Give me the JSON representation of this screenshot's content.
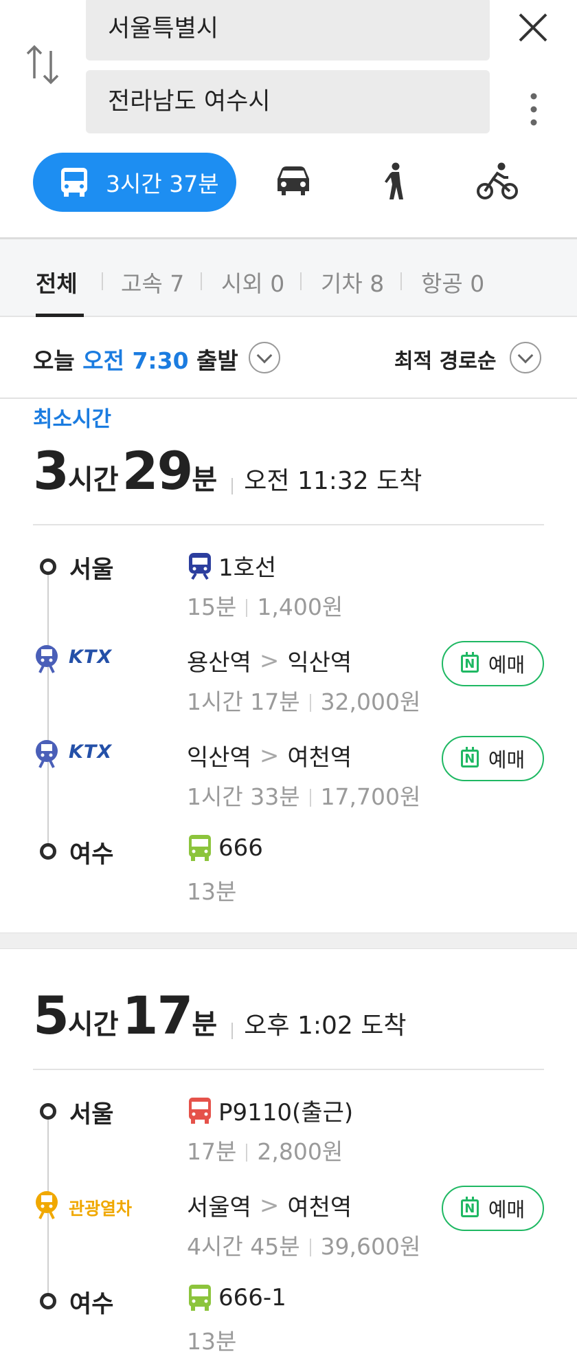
{
  "search": {
    "origin": "서울특별시",
    "destination": "전라남도 여수시"
  },
  "modes": {
    "transit_time": "3시간 37분",
    "icons": [
      "bus-icon",
      "car-icon",
      "walk-icon",
      "bicycle-icon"
    ],
    "accent": "#1d8ef2"
  },
  "filters": [
    {
      "label": "전체"
    },
    {
      "label": "고속 7"
    },
    {
      "label": "시외 0"
    },
    {
      "label": "기차 8"
    },
    {
      "label": "항공 0"
    }
  ],
  "departure": {
    "day": "오늘",
    "time": "오전 7:30",
    "suffix": "출발",
    "sort": "최적 경로순"
  },
  "routes": [
    {
      "badge": "최소시간",
      "hours": "3",
      "hours_unit": "시간",
      "minutes": "29",
      "minutes_unit": "분",
      "arrival": "오전 11:32 도착",
      "legs": [
        {
          "place": "서울",
          "line": "1호선",
          "time": "15분",
          "fare": "1,400원"
        },
        {
          "logo": "KTX",
          "from": "용산역",
          "to": "익산역",
          "time": "1시간 17분",
          "fare": "32,000원",
          "book": "예매"
        },
        {
          "logo": "KTX",
          "from": "익산역",
          "to": "여천역",
          "time": "1시간 33분",
          "fare": "17,700원",
          "book": "예매"
        },
        {
          "place": "여수",
          "line": "666",
          "time": "13분"
        }
      ]
    },
    {
      "hours": "5",
      "hours_unit": "시간",
      "minutes": "17",
      "minutes_unit": "분",
      "arrival": "오후 1:02 도착",
      "legs": [
        {
          "place": "서울",
          "line": "P9110(출근)",
          "time": "17분",
          "fare": "2,800원"
        },
        {
          "logo": "관광열차",
          "from": "서울역",
          "to": "여천역",
          "time": "4시간 45분",
          "fare": "39,600원",
          "book": "예매"
        },
        {
          "place": "여수",
          "line": "666-1",
          "time": "13분"
        }
      ]
    }
  ]
}
